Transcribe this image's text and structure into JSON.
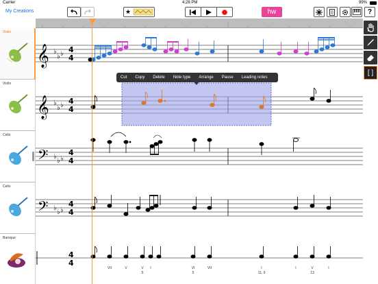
{
  "status": {
    "carrier": "Carrier",
    "time": "4:28 PM",
    "battery": "99%"
  },
  "toolbar": {
    "back_label": "My Creations",
    "undo_icon": "undo-icon",
    "redo_icon": "redo-icon",
    "hw_label": "hw"
  },
  "context_menu": [
    "Cut",
    "Copy",
    "Delete",
    "Note type",
    "Arrange",
    "Pause",
    "Leading notes"
  ],
  "tracks": [
    {
      "name": "Violin",
      "active": true
    },
    {
      "name": "Violin",
      "active": false
    },
    {
      "name": "Cello",
      "active": false
    },
    {
      "name": "Cello",
      "active": false
    },
    {
      "name": "Baroque",
      "active": false
    }
  ],
  "time_signature": {
    "top": "4",
    "bottom": "4"
  },
  "chord_labels": [
    {
      "top": "VII",
      "bottom": ""
    },
    {
      "top": "V",
      "bottom": ""
    },
    {
      "top": "V",
      "bottom": "5"
    },
    {
      "top": "I",
      "bottom": ""
    },
    {
      "top": "VI",
      "bottom": ""
    },
    {
      "top": "VI",
      "bottom": "5"
    },
    {
      "top": "VII",
      "bottom": ""
    },
    {
      "top": "I",
      "bottom": "11, 9"
    },
    {
      "top": "I",
      "bottom": ""
    },
    {
      "top": "V",
      "bottom": "13"
    },
    {
      "top": "I",
      "bottom": ""
    }
  ],
  "colors": {
    "playhead": "#ff9a3c",
    "accent": "#1a6fe0",
    "hw": "#e8449a",
    "selection": "#9aa0e6",
    "selected_note": "#d9782e",
    "blue_note": "#2a78d8",
    "pink_note": "#d33bd6"
  }
}
